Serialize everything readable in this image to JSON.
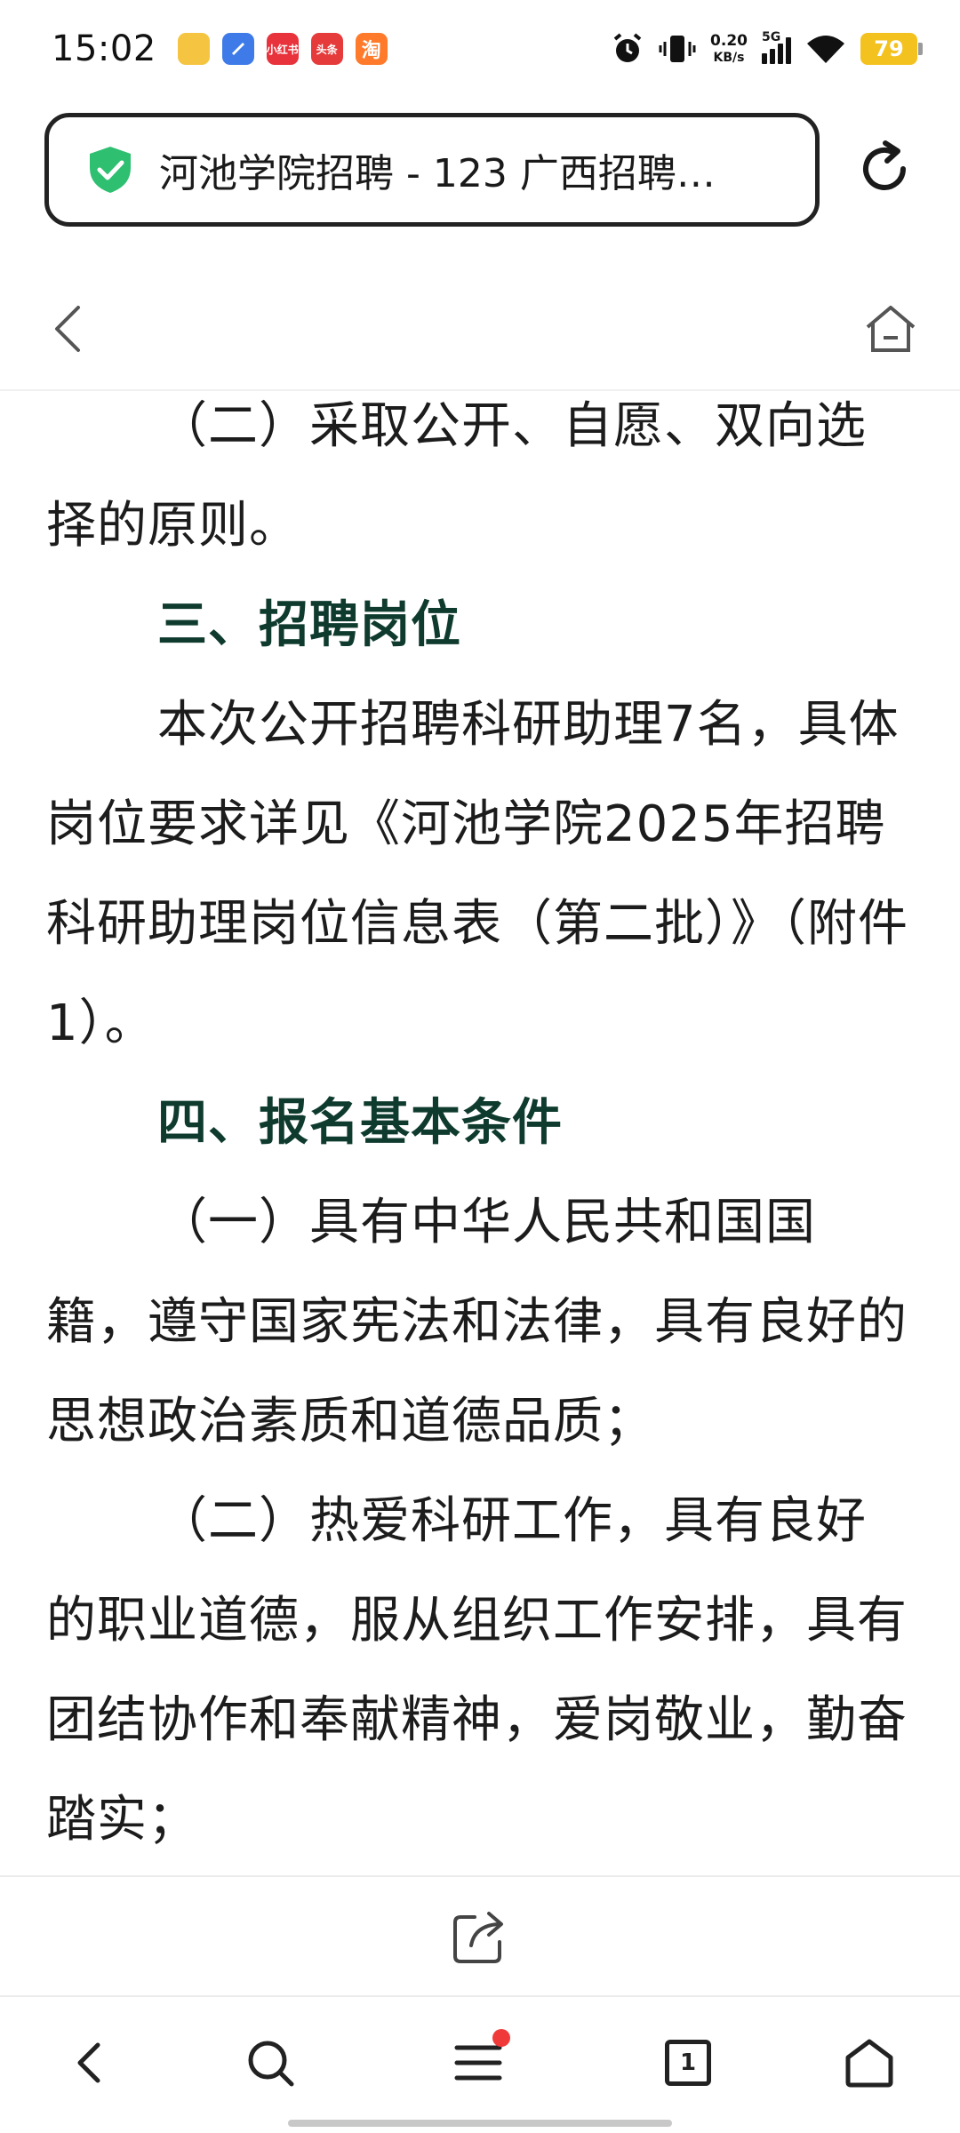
{
  "status_bar": {
    "time": "15:02",
    "apps": [
      {
        "name": "notes",
        "color": "#f5c542",
        "label": ""
      },
      {
        "name": "app-blue",
        "color": "#3e7be8",
        "label": ""
      },
      {
        "name": "xiaohongshu",
        "color": "#e8323c",
        "label": "小红书"
      },
      {
        "name": "toutiao",
        "color": "#e63b3b",
        "label": "头条"
      },
      {
        "name": "taobao",
        "color": "#ff7a2a",
        "label": "淘"
      }
    ],
    "net_speed_value": "0.20",
    "net_speed_unit": "KB/s",
    "network_gen": "5G",
    "battery": "79"
  },
  "url_bar": {
    "title": "河池学院招聘 - 123 广西招聘…"
  },
  "article": {
    "blocks": [
      {
        "type": "para",
        "text": "（二）采取公开、自愿、双向选择的原则。"
      },
      {
        "type": "heading",
        "text": "三、招聘岗位"
      },
      {
        "type": "para",
        "text": "本次公开招聘科研助理7名，具体岗位要求详见《河池学院2025年招聘科研助理岗位信息表（第二批）》（附件1）。"
      },
      {
        "type": "heading",
        "text": "四、报名基本条件"
      },
      {
        "type": "para",
        "text": "（一）具有中华人民共和国国籍，遵守国家宪法和法律，具有良好的思想政治素质和道德品质；"
      },
      {
        "type": "para",
        "text": "（二）热爱科研工作，具有良好的职业道德，服从组织工作安排，具有团结协作和奉献精神，爱岗敬业，勤奋踏实；"
      }
    ]
  },
  "bottom_nav": {
    "tab_count": "1"
  },
  "colors": {
    "heading": "#0f3b2e",
    "shield": "#2fbf71",
    "badge_dot": "#f03a3a",
    "battery": "#f4c21f"
  }
}
